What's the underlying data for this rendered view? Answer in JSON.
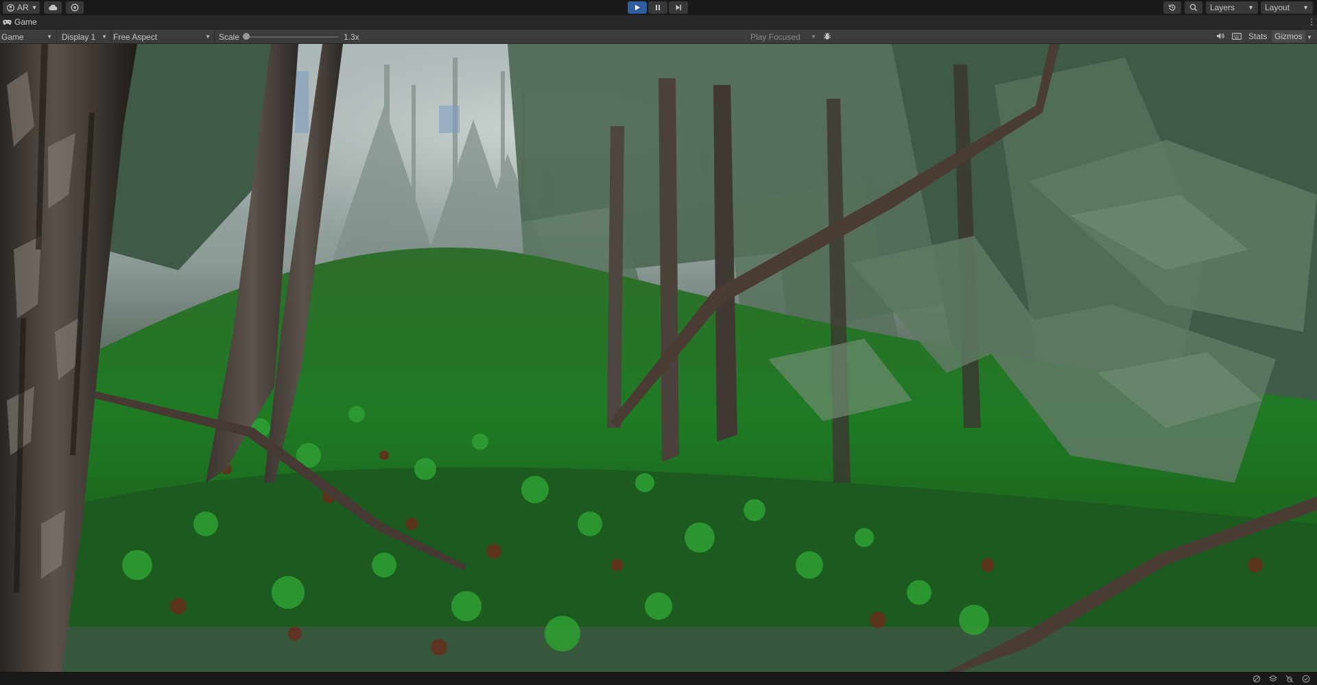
{
  "toolbar": {
    "account_label": "AR",
    "layers_label": "Layers",
    "layout_label": "Layout",
    "play_state": "playing"
  },
  "tab": {
    "title": "Game"
  },
  "gamebar": {
    "mode_value": "Game",
    "display_value": "Display 1",
    "aspect_value": "Free Aspect",
    "scale_label": "Scale",
    "scale_value": "1.3x",
    "scale_fraction": 0.0,
    "play_mode_value": "Play Focused",
    "stats_label": "Stats",
    "gizmos_label": "Gizmos"
  },
  "viewport": {
    "scene": "forest-game-view",
    "colors": {
      "fog": "#b9c3c2",
      "foliage_dark": "#2f4a34",
      "ground_green": "#1f7a23",
      "bark": "#4a3f37"
    }
  },
  "colors": {
    "toolbar_bg": "#191919",
    "tabstrip_bg": "#282828",
    "gamebar_bg": "#3c3c3c",
    "play_accent": "#2f5da0"
  }
}
